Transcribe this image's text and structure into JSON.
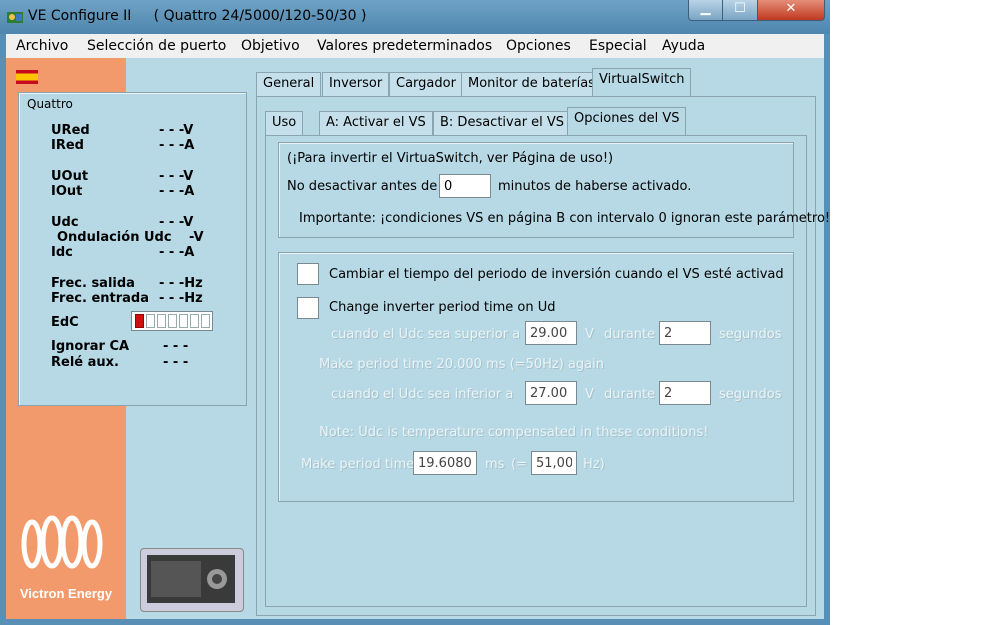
{
  "window": {
    "title": "VE Configure II     ( Quattro 24/5000/120-50/30 )",
    "controls": {
      "minimize": "▁",
      "maximize": "☐",
      "close": "✕"
    }
  },
  "menu": [
    "Archivo",
    "Selección de puerto",
    "Objetivo",
    "Valores predeterminados",
    "Opciones",
    "Especial",
    "Ayuda"
  ],
  "status": {
    "title": "Quattro",
    "rows": [
      {
        "label": "URed",
        "value": "- - -V"
      },
      {
        "label": "IRed",
        "value": "- - -A"
      },
      {
        "label": "UOut",
        "value": "- - -V"
      },
      {
        "label": "IOut",
        "value": "- - -A"
      },
      {
        "label": "Udc",
        "value": "- - -V"
      },
      {
        "label": "Ondulación Udc",
        "value": "-V"
      },
      {
        "label": "Idc",
        "value": "- - -A"
      },
      {
        "label": "Frec. salida",
        "value": "- - -Hz"
      },
      {
        "label": "Frec. entrada",
        "value": "- - -Hz"
      },
      {
        "label": "EdC",
        "value": ""
      },
      {
        "label": "Ignorar CA",
        "value": "- - -"
      },
      {
        "label": "Relé aux.",
        "value": "- - -"
      }
    ],
    "edc_level": 0.14
  },
  "logo_text": "Victron Energy",
  "tabs_main": [
    "General",
    "Inversor",
    "Cargador",
    "Monitor de baterías",
    "VirtualSwitch"
  ],
  "tabs_vs": [
    "Uso",
    "A: Activar el VS",
    "B: Desactivar el VS",
    "Opciones del VS"
  ],
  "group1": {
    "line1": "(¡Para invertir el VirtuaSwitch, ver Página de uso!)",
    "no_desactivar": "No desactivar antes de",
    "minutes_value": "0",
    "minutos": "minutos de haberse activado.",
    "importante": "Importante: ¡condiciones VS en página B con intervalo 0 ignoran este parámetro!"
  },
  "group2": {
    "chk1_label": "Cambiar el tiempo del periodo de inversión cuando el VS esté activad",
    "chk2_label": "Change inverter period time on Ud",
    "row1": {
      "a": "cuando el Udc sea superior a",
      "v1": "29.00",
      "u1": "V",
      "b": "durante",
      "v2": "2",
      "u2": "segundos"
    },
    "make20": "Make period time 20.000 ms (=50Hz) again",
    "row2": {
      "a": "cuando el Udc sea inferior a",
      "v1": "27.00",
      "u1": "V",
      "b": "durante",
      "v2": "2",
      "u2": "segundos"
    },
    "note": "Note: Udc is temperature compensated in these conditions!",
    "row3": {
      "a": "Make period time",
      "v1": "19.6080",
      "u1": "ms",
      "b": "(=",
      "v2": "51,00",
      "u2": "Hz)"
    }
  },
  "colors": {
    "orange": "#f29a6b",
    "panel": "#b6d9e5",
    "titlebar": "#5a8fb5",
    "close": "#c03a20"
  }
}
